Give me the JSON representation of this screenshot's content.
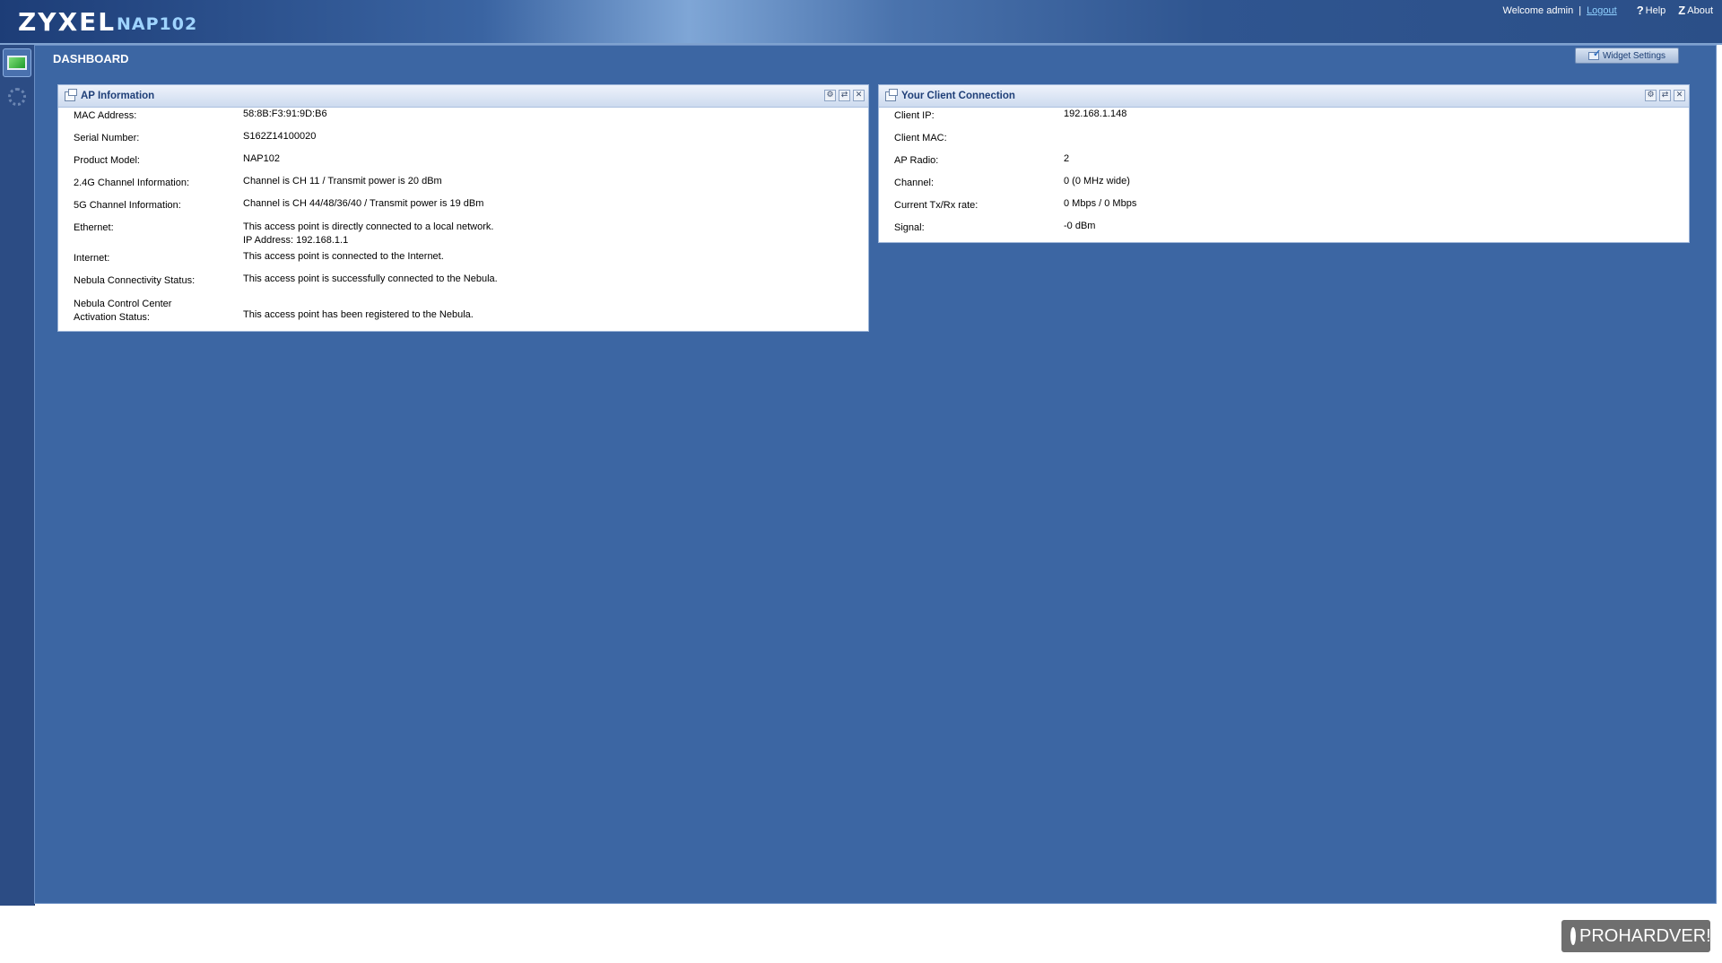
{
  "header": {
    "brand": "ZYXEL",
    "model": "NAP102",
    "welcome": "Welcome admin",
    "separator": "|",
    "logout": "Logout",
    "help": "Help",
    "about": "About",
    "help_glyph": "?",
    "about_glyph": "Z"
  },
  "nav": {
    "items": [
      {
        "icon": "dashboard-monitor-icon",
        "active": true
      },
      {
        "icon": "gear-icon",
        "active": false
      }
    ]
  },
  "page": {
    "title": "DASHBOARD",
    "widget_settings": "Widget Settings"
  },
  "ap_info": {
    "title": "AP Information",
    "rows": [
      {
        "label": "MAC Address:",
        "value": "58:8B:F3:91:9D:B6"
      },
      {
        "label": "Serial Number:",
        "value": "S162Z14100020"
      },
      {
        "label": "Product Model:",
        "value": "NAP102"
      },
      {
        "label": "2.4G Channel Information:",
        "value": "Channel is CH 11 / Transmit power is 20 dBm"
      },
      {
        "label": "5G Channel Information:",
        "value": "Channel is CH 44/48/36/40 / Transmit power is 19 dBm"
      },
      {
        "label": "Ethernet:",
        "value": "This access point is directly connected to a local network.\nIP Address: 192.168.1.1"
      },
      {
        "label": "Internet:",
        "value": "This access point is connected to the Internet."
      },
      {
        "label": "Nebula Connectivity Status:",
        "value": "This access point is successfully connected to the Nebula."
      },
      {
        "label": "Nebula Control Center\nActivation Status:",
        "value": "This access point has been registered to the Nebula."
      }
    ]
  },
  "client_conn": {
    "title": "Your Client Connection",
    "rows": [
      {
        "label": "Client IP:",
        "value": "192.168.1.148"
      },
      {
        "label": "Client MAC:",
        "value": ""
      },
      {
        "label": "AP Radio:",
        "value": "2"
      },
      {
        "label": "Channel:",
        "value": "0 (0 MHz wide)"
      },
      {
        "label": "Current Tx/Rx rate:",
        "value": "0 Mbps / 0 Mbps"
      },
      {
        "label": "Signal:",
        "value": "-0 dBm"
      }
    ]
  },
  "panel_tools": [
    "settings-icon",
    "refresh-icon",
    "close-icon"
  ],
  "watermark": "PROHARDVER!"
}
